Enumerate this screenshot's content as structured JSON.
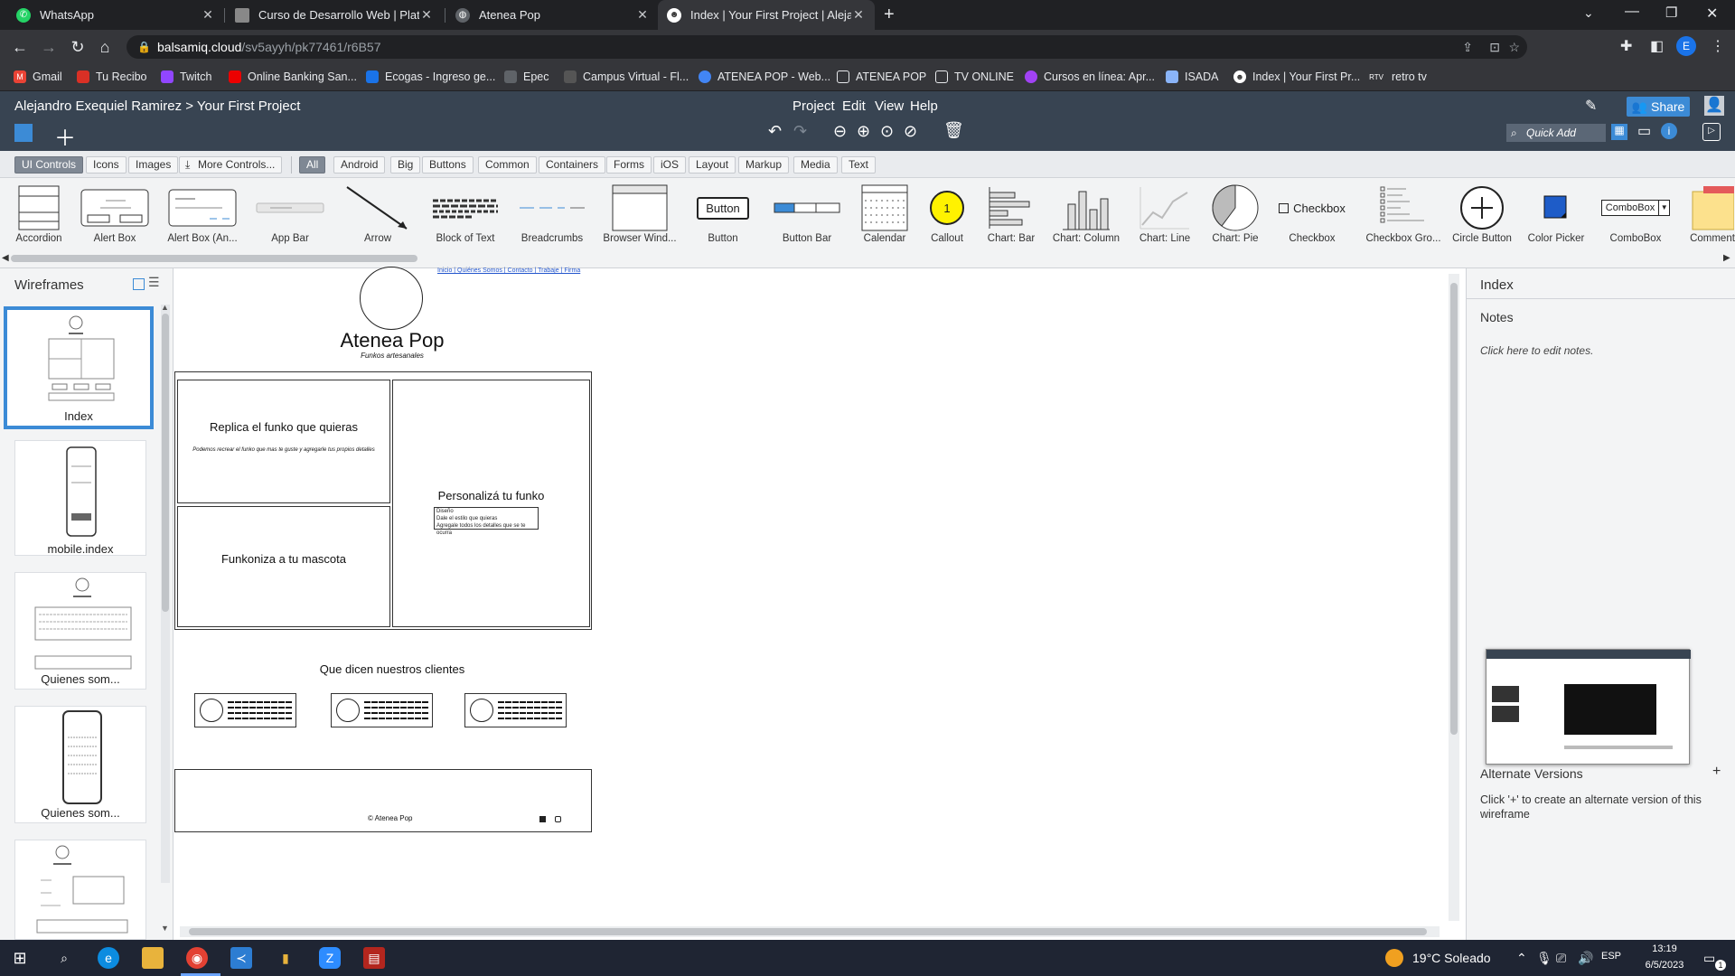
{
  "browser": {
    "tabs": [
      {
        "label": "WhatsApp",
        "color": "#25d366",
        "active": false
      },
      {
        "label": "Curso de Desarrollo Web | Plataf",
        "color": "#888888",
        "active": false
      },
      {
        "label": "Atenea Pop",
        "color": "#bbbbbb",
        "active": false
      },
      {
        "label": "Index | Your First Project | Alejand",
        "color": "#ffffff",
        "active": true
      }
    ],
    "new_tab": "+",
    "url_host": "balsamiq.cloud",
    "url_path": "/sv5ayyh/pk77461/r6B57",
    "profile_initial": "E",
    "bookmarks": [
      {
        "label": "Gmail",
        "color": "#ea4335"
      },
      {
        "label": "Tu Recibo",
        "color": "#d93025"
      },
      {
        "label": "Twitch",
        "color": "#9146ff"
      },
      {
        "label": "Online Banking San...",
        "color": "#ec0000"
      },
      {
        "label": "Ecogas - Ingreso ge...",
        "color": "#1a73e8"
      },
      {
        "label": "Epec",
        "color": "#e8eaed"
      },
      {
        "label": "Campus Virtual - Fl...",
        "color": "#555555"
      },
      {
        "label": "ATENEA POP - Web...",
        "color": "#4285f4"
      },
      {
        "label": "ATENEA POP",
        "color": "#e8eaed"
      },
      {
        "label": "TV ONLINE",
        "color": "#e8eaed"
      },
      {
        "label": "Cursos en línea: Apr...",
        "color": "#a142f4"
      },
      {
        "label": "ISADA",
        "color": "#e8eaed"
      },
      {
        "label": "Index | Your First Pr...",
        "color": "#ffffff"
      },
      {
        "label": "retro tv",
        "color": "#666666"
      }
    ],
    "bookmark_short": {
      "retro": "RTV"
    }
  },
  "balsamiq": {
    "breadcrumb": "Alejandro Exequiel Ramirez > Your First Project",
    "menu": [
      "Project",
      "Edit",
      "View",
      "Help"
    ],
    "share_label": "Share",
    "quick_add": "Quick Add",
    "filters": [
      "UI Controls",
      "Icons",
      "Images",
      "More Controls...",
      "All",
      "Android",
      "Big",
      "Buttons",
      "Common",
      "Containers",
      "Forms",
      "iOS",
      "Layout",
      "Markup",
      "Media",
      "Text"
    ],
    "controls": [
      {
        "label": "Accordion",
        "preview": ""
      },
      {
        "label": "Alert Box",
        "preview": ""
      },
      {
        "label": "Alert Box (An...",
        "preview": ""
      },
      {
        "label": "App Bar",
        "preview": ""
      },
      {
        "label": "Arrow",
        "preview": ""
      },
      {
        "label": "Block of Text",
        "preview": ""
      },
      {
        "label": "Breadcrumbs",
        "preview": ""
      },
      {
        "label": "Browser Wind...",
        "preview": ""
      },
      {
        "label": "Button",
        "preview": "Button"
      },
      {
        "label": "Button Bar",
        "preview": ""
      },
      {
        "label": "Calendar",
        "preview": ""
      },
      {
        "label": "Callout",
        "preview": "1"
      },
      {
        "label": "Chart: Bar",
        "preview": ""
      },
      {
        "label": "Chart: Column",
        "preview": ""
      },
      {
        "label": "Chart: Line",
        "preview": ""
      },
      {
        "label": "Chart: Pie",
        "preview": ""
      },
      {
        "label": "Checkbox",
        "preview": "Checkbox"
      },
      {
        "label": "Checkbox Gro...",
        "preview": ""
      },
      {
        "label": "Circle Button",
        "preview": ""
      },
      {
        "label": "Color Picker",
        "preview": ""
      },
      {
        "label": "ComboBox",
        "preview": "ComboBox"
      },
      {
        "label": "Comment",
        "preview": ""
      }
    ],
    "wireframes_title": "Wireframes",
    "wireframes": [
      "Index",
      "mobile.index",
      "Quienes som...",
      "Quienes som..."
    ],
    "right_panel": {
      "page_name": "Index",
      "notes_label": "Notes",
      "notes_hint": "Click here to edit notes.",
      "alt_versions": "Alternate Versions",
      "alt_plus": "+",
      "alt_hint": "Click '+' to create an alternate version of this wireframe"
    }
  },
  "wireframe": {
    "nav_links": "Inicio | Quiénes Somos | Contacto | Trabaje | Firma",
    "title": "Atenea Pop",
    "subtitle": "Funkos artesanales",
    "box1_title": "Replica el funko que quieras",
    "box1_text": "Podemos recrear el funko que mas te guste y agregarle tus propios detalles",
    "box2_title": "Personalizá tu funko",
    "box2_lines": [
      "Diseño",
      "Dale el estilo que quieras",
      "Agregale todos los detalles que se te ocurra"
    ],
    "box3_title": "Funkoniza a tu mascota",
    "reviews_title": "Que dicen nuestros clientes",
    "footer_text": "© Atenea Pop"
  },
  "taskbar": {
    "weather": "19°C  Soleado",
    "lang": "ESP",
    "time": "13:19",
    "date": "6/5/2023",
    "notif_count": "1"
  }
}
